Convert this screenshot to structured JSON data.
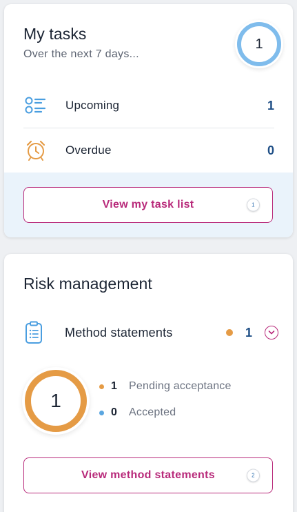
{
  "tasks": {
    "title": "My tasks",
    "subtitle": "Over the next 7 days...",
    "total": "1",
    "upcoming": {
      "label": "Upcoming",
      "count": "1"
    },
    "overdue": {
      "label": "Overdue",
      "count": "0"
    },
    "cta": {
      "label": "View my task list",
      "badge": "1"
    }
  },
  "risk": {
    "title": "Risk management",
    "method_statements": {
      "label": "Method statements",
      "count": "1"
    },
    "total": "1",
    "pending": {
      "count": "1",
      "label": "Pending acceptance"
    },
    "accepted": {
      "count": "0",
      "label": "Accepted"
    },
    "cta": {
      "label": "View method statements",
      "badge": "2"
    }
  },
  "colors": {
    "accent": "#b8297a",
    "count_blue": "#1f4f86",
    "ring_blue": "#7fbcec",
    "ring_orange": "#e59b45",
    "dot_accepted": "#5aa6e0"
  }
}
